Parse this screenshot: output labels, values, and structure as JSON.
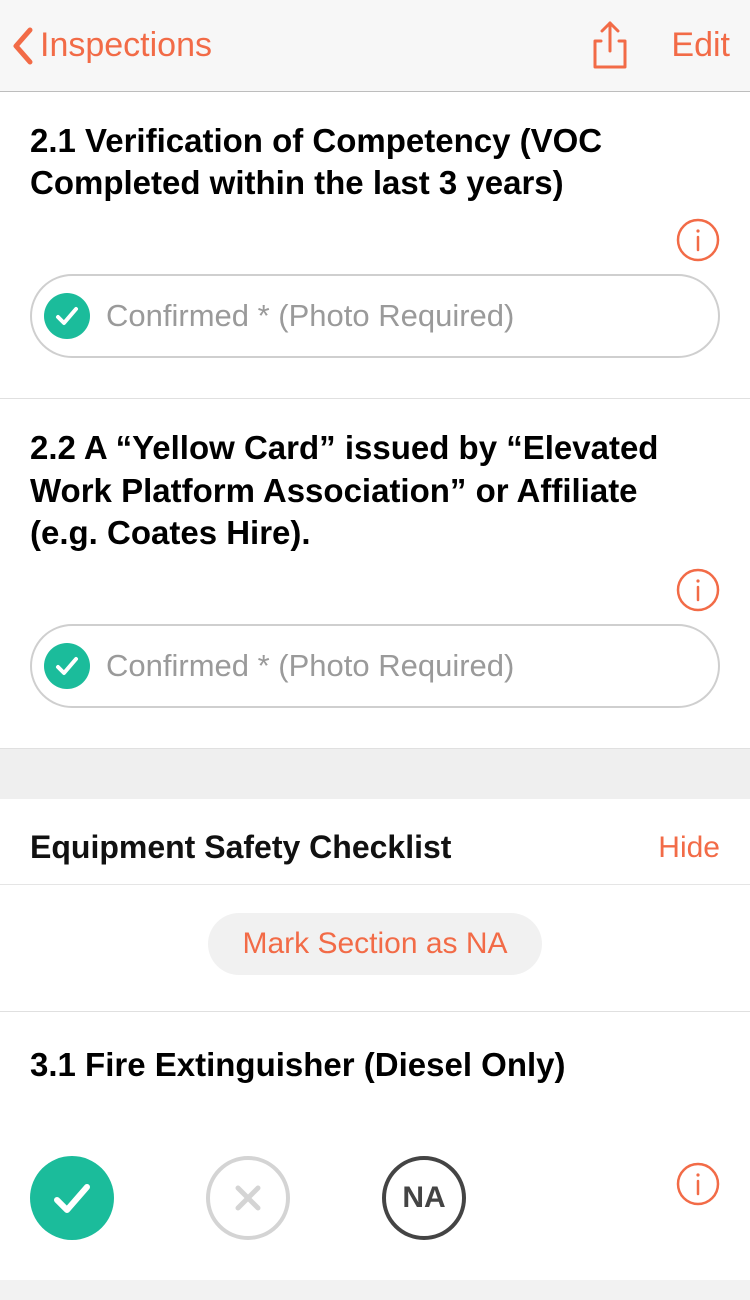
{
  "nav": {
    "back_label": "Inspections",
    "edit_label": "Edit"
  },
  "questions": [
    {
      "title": "2.1 Verification of Competency (VOC Completed within the last 3 years)",
      "confirm_label": "Confirmed * (Photo Required)"
    },
    {
      "title": "2.2 A “Yellow Card” issued by “Elevated Work Platform Association” or Affiliate (e.g. Coates Hire).",
      "confirm_label": "Confirmed * (Photo Required)"
    }
  ],
  "section": {
    "title": "Equipment Safety Checklist",
    "hide_label": "Hide",
    "mark_na_label": "Mark Section as NA"
  },
  "q3": {
    "title": "3.1 Fire Extinguisher (Diesel Only)",
    "na_label": "NA"
  }
}
